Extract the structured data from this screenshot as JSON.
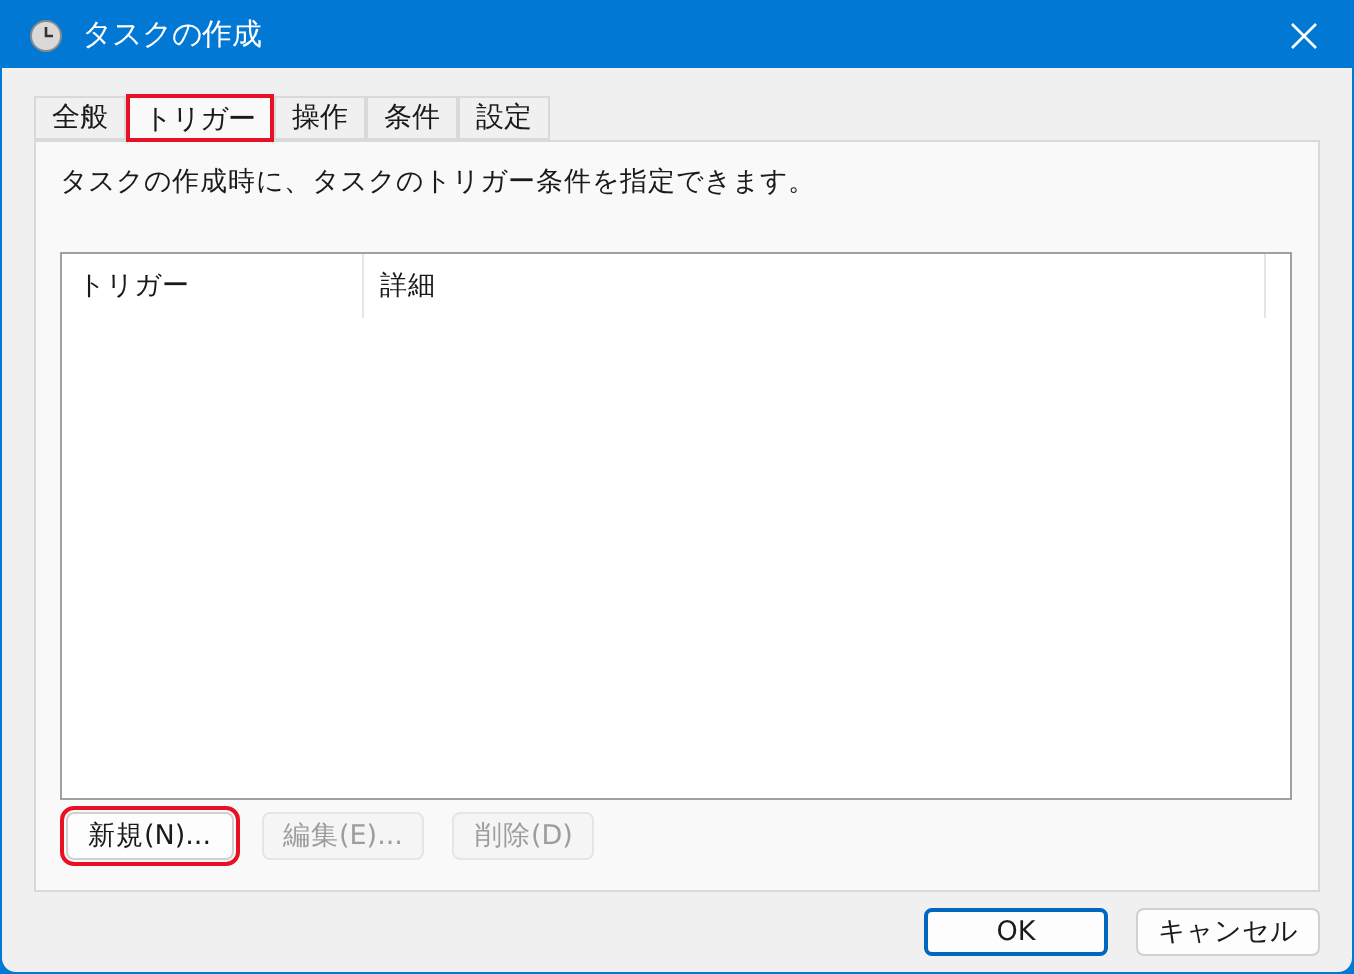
{
  "window": {
    "title": "タスクの作成"
  },
  "tabs": [
    {
      "label": "全般",
      "selected": false,
      "highlighted": false
    },
    {
      "label": "トリガー",
      "selected": true,
      "highlighted": true
    },
    {
      "label": "操作",
      "selected": false,
      "highlighted": false
    },
    {
      "label": "条件",
      "selected": false,
      "highlighted": false
    },
    {
      "label": "設定",
      "selected": false,
      "highlighted": false
    }
  ],
  "description": "タスクの作成時に、タスクのトリガー条件を指定できます。",
  "table": {
    "columns": [
      "トリガー",
      "詳細"
    ]
  },
  "list_buttons": [
    {
      "label": "新規(N)...",
      "disabled": false,
      "highlighted": true
    },
    {
      "label": "編集(E)...",
      "disabled": true,
      "highlighted": false
    },
    {
      "label": "削除(D)",
      "disabled": true,
      "highlighted": false
    }
  ],
  "dialog_buttons": [
    {
      "label": "OK",
      "default": true
    },
    {
      "label": "キャンセル",
      "default": false
    }
  ]
}
